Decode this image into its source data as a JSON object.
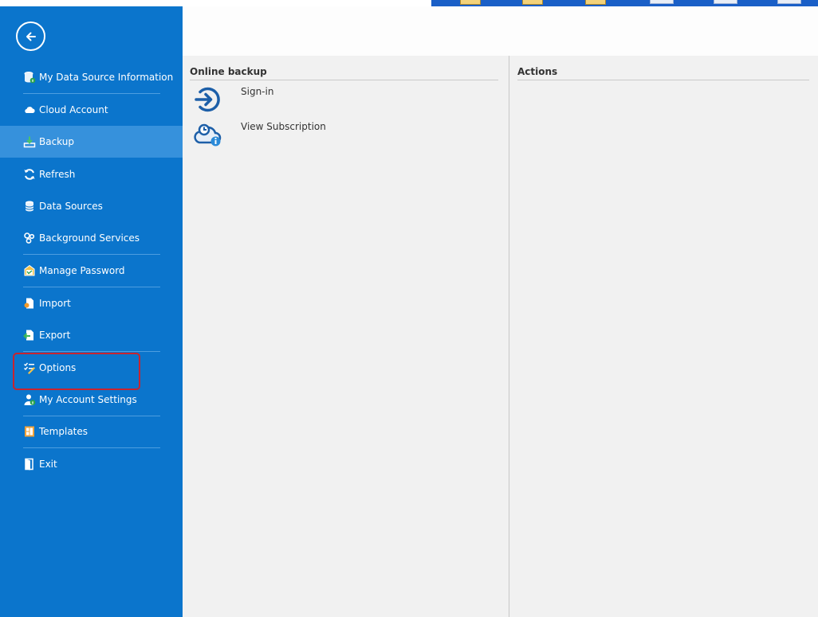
{
  "window": {
    "title": ""
  },
  "sidebar": {
    "back_icon": "arrow-left-circle-icon",
    "items": [
      {
        "id": "my-data-source-information",
        "label": "My Data Source Information",
        "icon": "database-info-icon"
      },
      {
        "id": "cloud-account",
        "label": "Cloud Account",
        "icon": "cloud-icon"
      },
      {
        "id": "backup",
        "label": "Backup",
        "icon": "backup-download-icon",
        "selected": true
      },
      {
        "id": "refresh",
        "label": "Refresh",
        "icon": "refresh-icon"
      },
      {
        "id": "data-sources",
        "label": "Data Sources",
        "icon": "database-icon"
      },
      {
        "id": "background-services",
        "label": "Background Services",
        "icon": "services-icon"
      },
      {
        "id": "manage-password",
        "label": "Manage Password",
        "icon": "password-icon"
      },
      {
        "id": "import",
        "label": "Import",
        "icon": "import-icon"
      },
      {
        "id": "export",
        "label": "Export",
        "icon": "export-icon"
      },
      {
        "id": "options",
        "label": "Options",
        "icon": "options-checklist-icon",
        "highlighted": true
      },
      {
        "id": "my-account-settings",
        "label": "My Account Settings",
        "icon": "account-settings-icon"
      },
      {
        "id": "templates",
        "label": "Templates",
        "icon": "templates-icon"
      },
      {
        "id": "exit",
        "label": "Exit",
        "icon": "exit-door-icon"
      }
    ]
  },
  "main": {
    "online_backup": {
      "title": "Online backup",
      "actions": [
        {
          "label": "Sign-in",
          "icon": "sign-in-icon"
        },
        {
          "label": "View Subscription",
          "icon": "subscription-cloud-icon"
        }
      ]
    },
    "actions_panel": {
      "title": "Actions"
    }
  },
  "colors": {
    "sidebar_bg": "#0b75cc",
    "sidebar_selected": "#3691dc",
    "highlight_border": "#c8242f",
    "content_bg": "#f1f1f1",
    "icon_blue": "#1d5fa8"
  }
}
